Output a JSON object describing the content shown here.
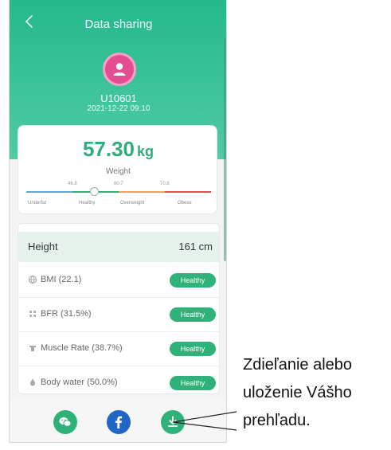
{
  "header": {
    "title": "Data sharing",
    "back_icon": "chevron-left-icon",
    "user_id": "U10601",
    "datetime": "2021-12-22 09:10",
    "bg_color": "#2bbb8d"
  },
  "weight": {
    "value": "57.30",
    "unit": "kg",
    "label": "Weight",
    "thresholds": [
      "46.8",
      "60.7",
      "70.8"
    ],
    "categories": [
      "Underfat",
      "Healthy",
      "Overweight",
      "Obese"
    ],
    "segment_colors": [
      "#6aa7d8",
      "#2eb27a",
      "#f0a060",
      "#e05050"
    ],
    "accent_color": "#2eac7a"
  },
  "metrics": {
    "height_label": "Height",
    "height_value": "161 cm",
    "rows": [
      {
        "icon": "globe-icon",
        "label": "BMI (22.1)",
        "status": "Healthy"
      },
      {
        "icon": "grid-icon",
        "label": "BFR (31.5%)",
        "status": "Healthy"
      },
      {
        "icon": "muscle-icon",
        "label": "Muscle Rate (38.7%)",
        "status": "Healthy"
      },
      {
        "icon": "drop-icon",
        "label": "Body water (50.0%)",
        "status": "Healthy"
      }
    ],
    "badge_color": "#2eb27a"
  },
  "share": {
    "buttons": [
      {
        "name": "wechat",
        "icon": "wechat-icon",
        "color": "#2eb27a"
      },
      {
        "name": "facebook",
        "icon": "facebook-icon",
        "color": "#1f66c7"
      },
      {
        "name": "download",
        "icon": "download-icon",
        "color": "#2eb27a"
      }
    ]
  },
  "callout": {
    "text": "Zdieľanie alebo uloženie Vášho prehľadu."
  }
}
